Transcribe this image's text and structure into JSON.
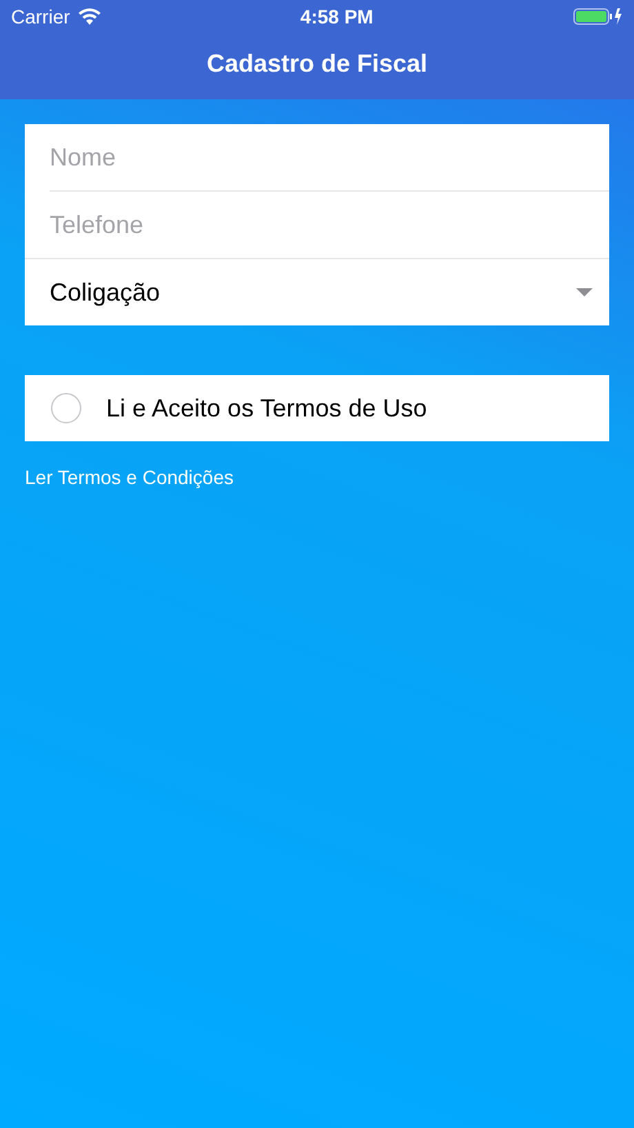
{
  "status_bar": {
    "carrier": "Carrier",
    "time": "4:58 PM"
  },
  "nav_bar": {
    "title": "Cadastro de Fiscal"
  },
  "form": {
    "fields": [
      {
        "kind": "text",
        "placeholder": "Nome"
      },
      {
        "kind": "text",
        "placeholder": "Telefone"
      },
      {
        "kind": "select",
        "value": "Coligação"
      }
    ]
  },
  "terms": {
    "label": "Li e Aceito os Termos de Uso",
    "checked": false
  },
  "link": "Ler Termos e Condições"
}
